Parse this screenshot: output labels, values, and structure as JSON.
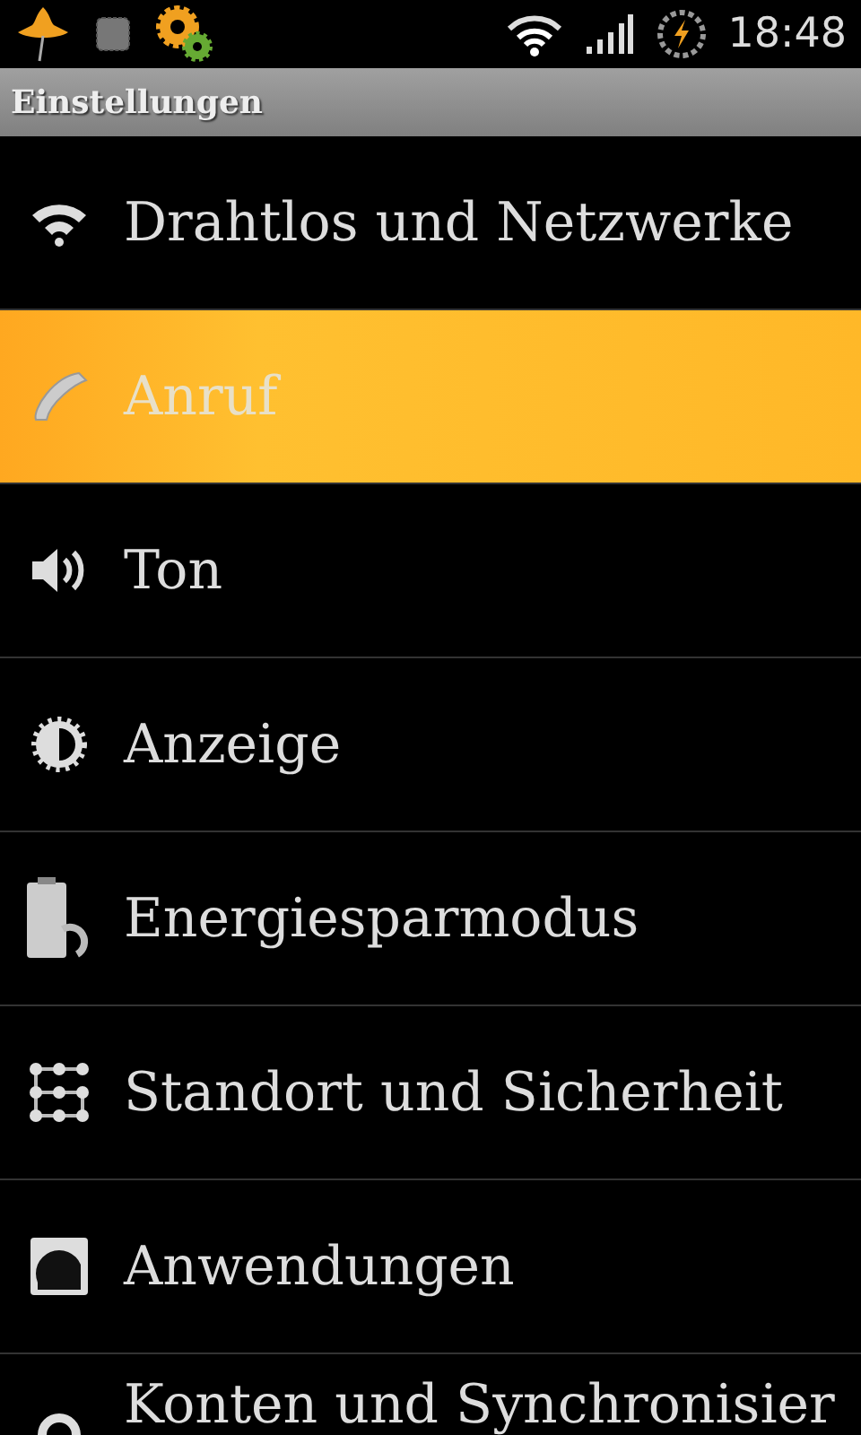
{
  "status_bar": {
    "time": "18:48"
  },
  "title_bar": {
    "title": "Einstellungen"
  },
  "items": [
    {
      "label": "Drahtlos und Netzwerke",
      "selected": false
    },
    {
      "label": "Anruf",
      "selected": true
    },
    {
      "label": "Ton",
      "selected": false
    },
    {
      "label": "Anzeige",
      "selected": false
    },
    {
      "label": "Energiesparmodus",
      "selected": false
    },
    {
      "label": "Standort und Sicherheit",
      "selected": false
    },
    {
      "label": "Anwendungen",
      "selected": false
    },
    {
      "label": "Konten und Synchronisier",
      "selected": false
    }
  ]
}
